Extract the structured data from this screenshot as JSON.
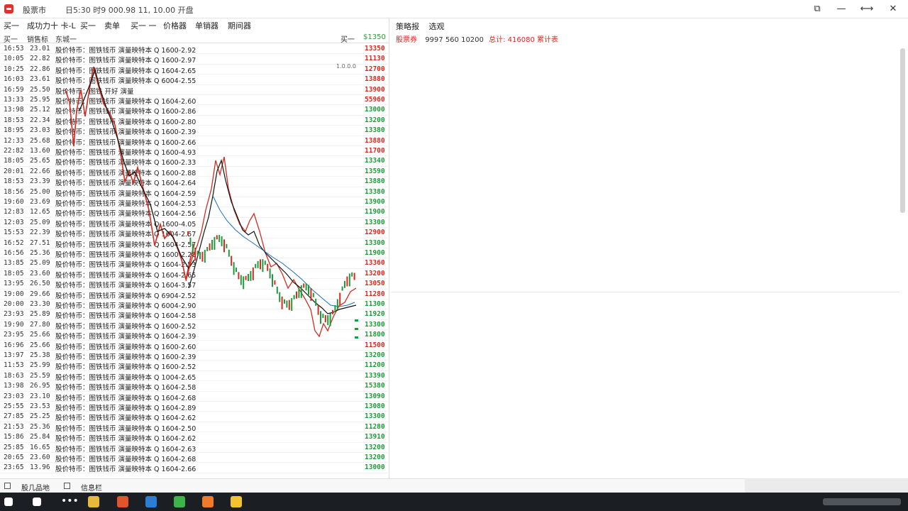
{
  "window": {
    "app_title": "股票市",
    "info": "日5:30 时9 000.98 11, 10.00 开盘",
    "controls": {
      "restore": "⧉",
      "minimize": "—",
      "maximize": "⟷",
      "close": "✕"
    }
  },
  "menu": [
    "买一",
    "成功力十 卡-L",
    "买一",
    "卖单",
    "买一 一",
    "价格器",
    "单销器",
    "期间器"
  ],
  "columns": {
    "time": "买一",
    "price": "销售标",
    "text": "东城一"
  },
  "buy": {
    "label": "买一",
    "price": "$1350"
  },
  "overlay_label": "1.0.0.0",
  "rows": [
    {
      "time": "16:53",
      "price": "23.01",
      "text": "股价特币：图铁钱币 演量映特本 Q 1600-2.92",
      "value": "13350",
      "dir": "up"
    },
    {
      "time": "10:05",
      "price": "22.82",
      "text": "股价特币：图铁钱币 演量映特本 Q 1600-2.97",
      "value": "11130",
      "dir": "up"
    },
    {
      "time": "10:25",
      "price": "22.86",
      "text": "股价特币：图铁钱币 演量映特本 Q 1604-2.65",
      "value": "12700",
      "dir": "up"
    },
    {
      "time": "16:03",
      "price": "23.61",
      "text": "股价特币：图铁钱币 演量映特本 Q 6004-2.55",
      "value": "13880",
      "dir": "up"
    },
    {
      "time": "16:59",
      "price": "25.50",
      "text": "股价特币：图铁 开好 演量",
      "value": "13900",
      "dir": "up"
    },
    {
      "time": "13:33",
      "price": "25.95",
      "text": "股价特币：图铁钱币 演量映特本 Q 1604-2.60",
      "value": "55960",
      "dir": "up"
    },
    {
      "time": "13:98",
      "price": "25.12",
      "text": "股价特币：图铁钱币 演量映特本 Q 1600-2.86",
      "value": "13000",
      "dir": "down"
    },
    {
      "time": "18:53",
      "price": "22.34",
      "text": "股价特币：图铁钱币 演量映特本 Q 1600-2.80",
      "value": "13200",
      "dir": "down"
    },
    {
      "time": "18:95",
      "price": "23.03",
      "text": "股价特币：图铁钱币 演量映特本 Q 1600-2.39",
      "value": "13380",
      "dir": "down"
    },
    {
      "time": "12:33",
      "price": "25.68",
      "text": "股价特币：图铁钱币 演量映特本 Q 1600-2.66",
      "value": "13880",
      "dir": "up"
    },
    {
      "time": "22:82",
      "price": "13.60",
      "text": "股价特币：图铁钱币 演量映特本 Q 1600-4.93",
      "value": "11700",
      "dir": "up"
    },
    {
      "time": "18:05",
      "price": "25.65",
      "text": "股价特币：图铁钱币 演量映特本 Q 1600-2.33",
      "value": "13340",
      "dir": "down"
    },
    {
      "time": "20:01",
      "price": "22.66",
      "text": "股价特币：图铁钱币 演量映特本 Q 1600-2.88",
      "value": "13590",
      "dir": "down"
    },
    {
      "time": "18:53",
      "price": "23.39",
      "text": "股价特币：图铁钱币 演量映特本 Q 1604-2.64",
      "value": "13880",
      "dir": "down"
    },
    {
      "time": "18:56",
      "price": "25.00",
      "text": "股价特币：图铁钱币 演量映特本 Q 1604-2.59",
      "value": "13380",
      "dir": "down"
    },
    {
      "time": "19:60",
      "price": "23.69",
      "text": "股价特币：图铁钱币 演量映特本 Q 1604-2.53",
      "value": "13900",
      "dir": "down"
    },
    {
      "time": "12:83",
      "price": "12.65",
      "text": "股价特币：图铁钱币 演量映特本 Q 1604-2.56",
      "value": "11900",
      "dir": "down"
    },
    {
      "time": "12:03",
      "price": "25.09",
      "text": "股价特币：图铁钱币 演量映特本 Q 1600-4.05",
      "value": "13300",
      "dir": "down"
    },
    {
      "time": "15:53",
      "price": "22.39",
      "text": "股价特币：图铁钱币 演量映特本 Q 1604-2.57",
      "value": "12900",
      "dir": "up"
    },
    {
      "time": "16:52",
      "price": "27.51",
      "text": "股价特币：图铁钱币 演量映特本 Q 1604-2.57",
      "value": "13300",
      "dir": "down"
    },
    {
      "time": "16:56",
      "price": "25.36",
      "text": "股价特币：图铁钱币 演量映特本 Q 1600-2.28",
      "value": "11900",
      "dir": "down"
    },
    {
      "time": "13:85",
      "price": "25.09",
      "text": "股价特币：图铁钱币 演量映特本 Q 1604-2.53",
      "value": "13360",
      "dir": "up"
    },
    {
      "time": "18:05",
      "price": "23.60",
      "text": "股价特币：图铁钱币 演量映特本 Q 1604-2.65",
      "value": "13200",
      "dir": "up"
    },
    {
      "time": "13:95",
      "price": "26.50",
      "text": "股价特币：图铁钱币 演量映特本 Q 1604-3.57",
      "value": "13050",
      "dir": "up"
    },
    {
      "time": "19:00",
      "price": "29.66",
      "text": "股价特币：图铁钱币 演量映特本 Q 6904-2.52",
      "value": "11280",
      "dir": "up"
    },
    {
      "time": "20:00",
      "price": "23.30",
      "text": "股价特币：图铁钱币 演量映特本 Q 6004-2.90",
      "value": "11300",
      "dir": "down"
    },
    {
      "time": "23:93",
      "price": "25.89",
      "text": "股价特币：图铁钱币 演量映特本 Q 1604-2.58",
      "value": "11920",
      "dir": "down"
    },
    {
      "time": "19:90",
      "price": "27.80",
      "text": "股价特币：图铁钱币 演量映特本 Q 1600-2.52",
      "value": "13300",
      "dir": "down"
    },
    {
      "time": "23:95",
      "price": "25.66",
      "text": "股价特币：图铁钱币 演量映特本 Q 1604-2.39",
      "value": "11800",
      "dir": "down"
    },
    {
      "time": "16:96",
      "price": "25.66",
      "text": "股价特币：图铁钱币 演量映特本 Q 1600-2.60",
      "value": "11500",
      "dir": "up"
    },
    {
      "time": "13:97",
      "price": "25.38",
      "text": "股价特币：图铁钱币 演量映特本 Q 1600-2.39",
      "value": "13200",
      "dir": "down"
    },
    {
      "time": "11:53",
      "price": "25.99",
      "text": "股价特币：图铁钱币 演量映特本 Q 1600-2.52",
      "value": "11200",
      "dir": "down"
    },
    {
      "time": "18:63",
      "price": "25.59",
      "text": "股价特币：图铁钱币 演量映特本 Q 1004-2.65",
      "value": "13390",
      "dir": "down"
    },
    {
      "time": "13:98",
      "price": "26.95",
      "text": "股价特币：图铁钱币 演量映特本 Q 1604-2.58",
      "value": "15380",
      "dir": "down"
    },
    {
      "time": "23:03",
      "price": "23.10",
      "text": "股价特币：图铁钱币 演量映特本 Q 1604-2.68",
      "value": "13090",
      "dir": "down"
    },
    {
      "time": "25:55",
      "price": "23.53",
      "text": "股价特币：图铁钱币 演量映特本 Q 1604-2.89",
      "value": "13080",
      "dir": "down"
    },
    {
      "time": "27:85",
      "price": "25.25",
      "text": "股价特币：图铁钱币 演量映特本 Q 1604-2.62",
      "value": "13300",
      "dir": "down"
    },
    {
      "time": "21:53",
      "price": "25.36",
      "text": "股价特币：图铁钱币 演量映特本 Q 1604-2.50",
      "value": "11280",
      "dir": "down"
    },
    {
      "time": "15:86",
      "price": "25.84",
      "text": "股价特币：图铁钱币 演量映特本 Q 1604-2.62",
      "value": "13910",
      "dir": "down"
    },
    {
      "time": "25:85",
      "price": "16.65",
      "text": "股价特币：图铁钱币 演量映特本 Q 1604-2.63",
      "value": "13200",
      "dir": "down"
    },
    {
      "time": "20:65",
      "price": "23.60",
      "text": "股价特币：图铁钱币 演量映特本 Q 1604-2.68",
      "value": "13200",
      "dir": "down"
    },
    {
      "time": "23:65",
      "price": "13.96",
      "text": "股价特币：图铁钱币 演量映特本 Q 1604-2.66",
      "value": "13000",
      "dir": "down"
    }
  ],
  "right_panel": {
    "tabs": [
      "策略报",
      "选观"
    ],
    "label": "股票券",
    "info": "9997 560 10200",
    "total": "总计: 416080 累计表"
  },
  "statusbar": {
    "left": "股几品地",
    "right": "信息栏"
  },
  "colors": {
    "up": "#d42a1f",
    "down": "#1f9a3a",
    "line_red": "#d42a1f",
    "line_black": "#111111",
    "line_blue": "#1c6fb8"
  },
  "icons": [
    "app-icon",
    "restore-icon",
    "minimize-icon",
    "maximize-icon",
    "close-icon",
    "status-grid-icon",
    "start-icon",
    "search-icon",
    "task-view-icon",
    "folder-icon",
    "browser-icon",
    "store-icon",
    "chat-icon",
    "settings-icon",
    "vpn-icon"
  ]
}
